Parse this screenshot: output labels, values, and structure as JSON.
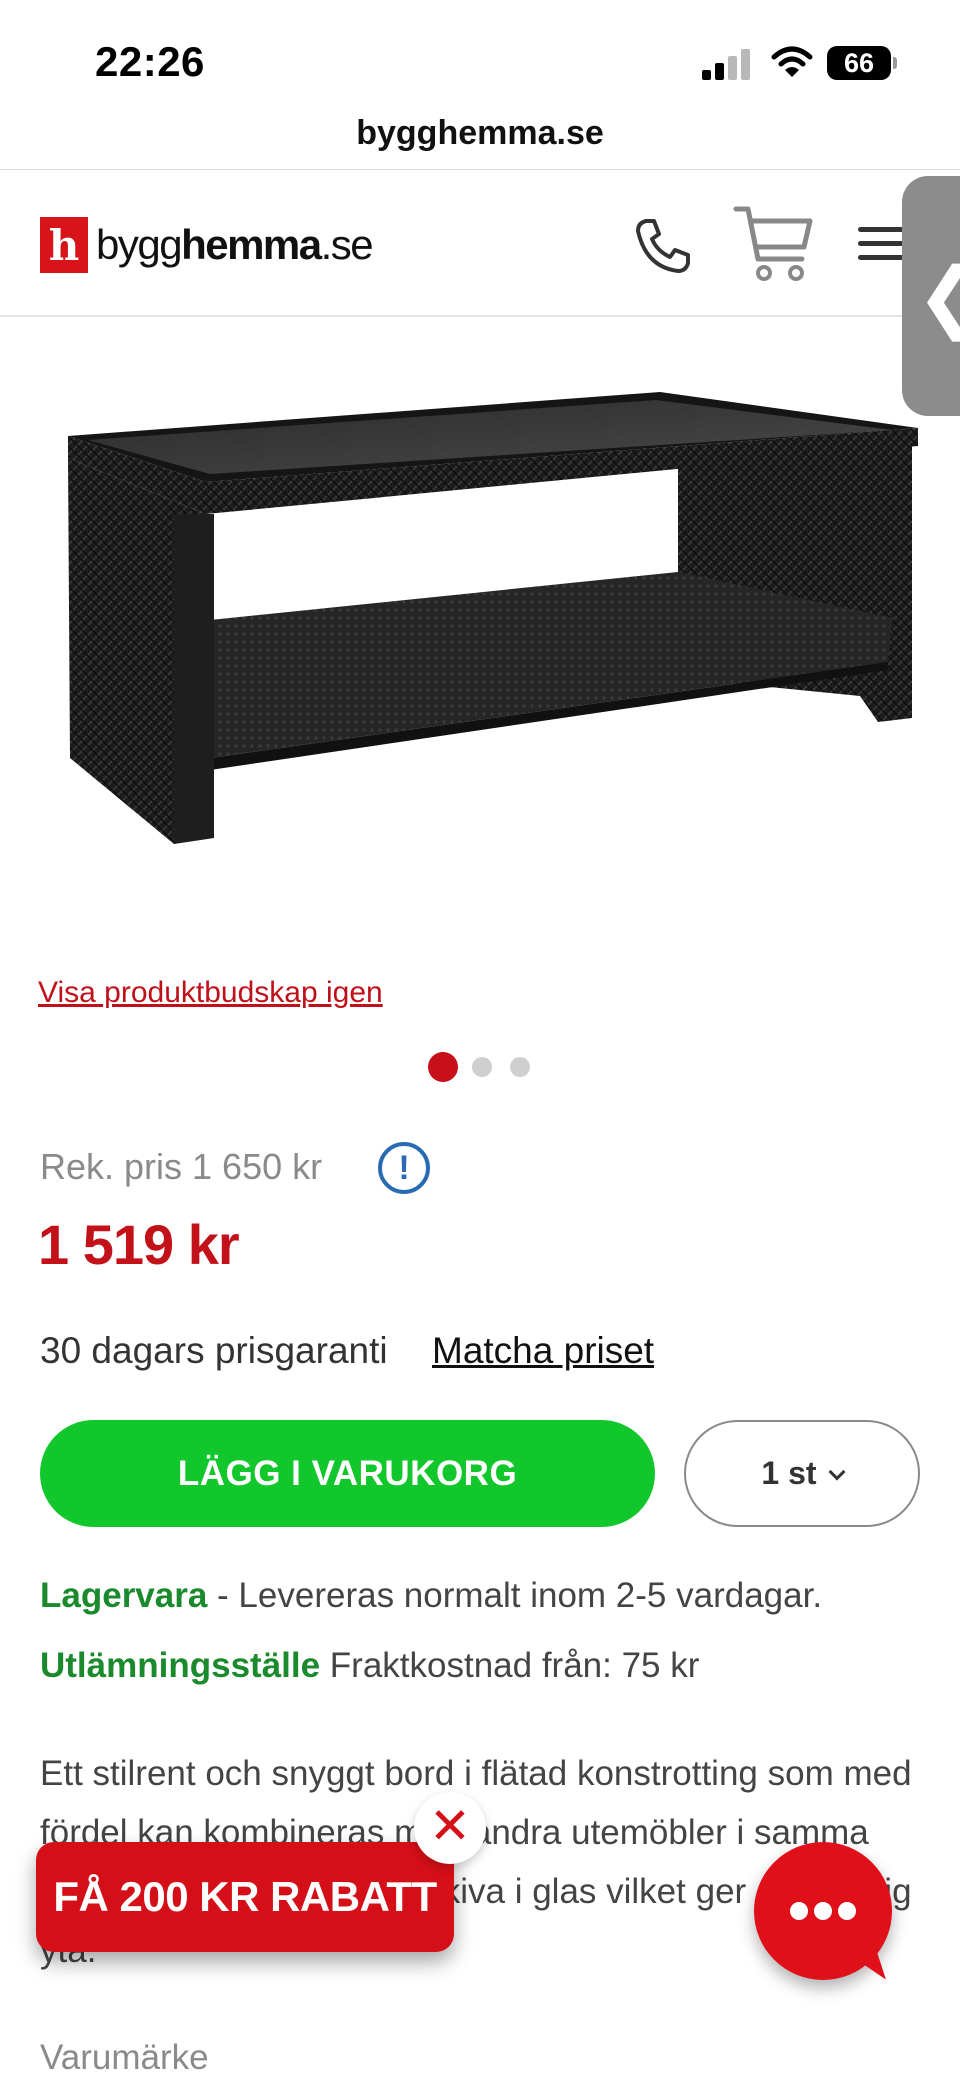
{
  "status_bar": {
    "time": "22:26",
    "battery": "66"
  },
  "browser": {
    "url": "bygghemma.se"
  },
  "header": {
    "logo_mark": "h",
    "logo_text_regular": "bygg",
    "logo_text_bold": "hemma",
    "logo_text_suffix": ".se",
    "icons": [
      "phone-icon",
      "cart-icon",
      "menu-icon"
    ]
  },
  "side_tab": {
    "glyph": "❮"
  },
  "product": {
    "image_alt": "Black rattan coffee table with glass top",
    "show_message_link": "Visa produktbudskap igen",
    "gallery": {
      "total": 3,
      "active": 1
    },
    "rec_price": "Rek. pris 1 650 kr",
    "info_glyph": "!",
    "price": "1 519 kr",
    "guarantee_text": "30 dagars prisgaranti",
    "match_price_link": "Matcha priset",
    "add_to_cart": "LÄGG I VARUKORG",
    "quantity": "1 st",
    "stock_label": "Lagervara",
    "stock_text": " - Levereras normalt inom 2-5 vardagar.",
    "pickup_label": "Utlämningsställe",
    "pickup_text": " Fraktkostnad från: 75 kr",
    "description": "Ett stilrent och snyggt bord i flätad konstrotting som med fördel kan kombineras med andra utemöbler i samma serie. Bordet har en toppskiva i glas vilket ger en slittålig yta.",
    "brand_label": "Varumärke"
  },
  "promo": {
    "label": "FÅ 200 KR RABATT",
    "close_glyph": "✕"
  },
  "colors": {
    "brand_red": "#d50f17",
    "buy_green": "#12c72c",
    "stock_green": "#1a8a2c",
    "info_blue": "#2a6ab3"
  }
}
